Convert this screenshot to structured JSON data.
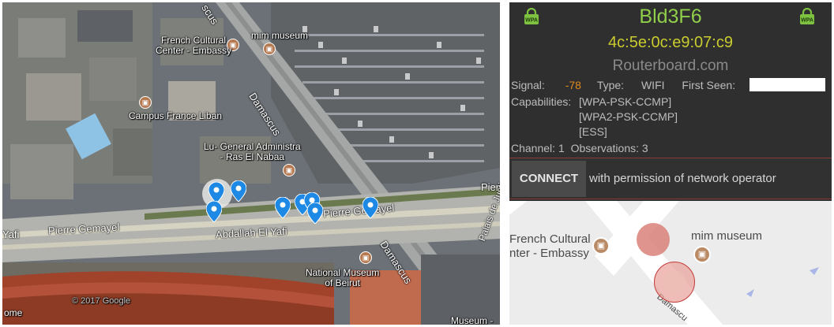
{
  "satellite_map": {
    "labels": {
      "french_cultural": "French Cultural\nCenter - Embassy",
      "mim_museum": "mim museum",
      "campus_france": "Campus France Liban",
      "lu_general": "Lu- General Administra\n- Ras El Nabaa",
      "national_museum": "National Museum\nof Beirut",
      "museum_short": "Museum -"
    },
    "roads": {
      "damascus_top": "Damascus",
      "damascus_bottom": "Damascus",
      "pierre_gemayel_left": "Pierre Gemayel",
      "pierre_gemayel_mid": "Pierre Gemayel",
      "pierre_gemayel_right": "Pierr",
      "abdallah": "Abdallah El Yafi",
      "yafi_left": "Yafi",
      "palais": "Palais de Justi",
      "scus": "scus"
    },
    "watermark": "© 2017 Google",
    "corner_text": "ome"
  },
  "network": {
    "ssid": "Bld3F6",
    "bssid": "4c:5e:0c:e9:07:c9",
    "vendor": "Routerboard.com",
    "signal_label": "Signal:",
    "signal_value": "-78",
    "type_label": "Type:",
    "type_value": "WIFI",
    "first_seen_label": "First Seen:",
    "capabilities_label": "Capabilities:",
    "capabilities": [
      "[WPA-PSK-CCMP]",
      "[WPA2-PSK-CCMP]",
      "[ESS]"
    ],
    "channel_label": "Channel:",
    "channel_value": "1",
    "observations_label": "Observations:",
    "observations_value": "3",
    "security_badge": "WPA"
  },
  "connect": {
    "button_label": "CONNECT",
    "note": "with permission of network operator"
  },
  "mini_map": {
    "french_cultural": "French Cultural\nnter - Embassy",
    "mim_museum": "mim museum",
    "damascus": "Damascu"
  },
  "colors": {
    "ssid": "#8fcf4a",
    "bssid": "#c9cc2e",
    "signal": "#e08a1e",
    "panel_bg": "#2f2f2f"
  }
}
